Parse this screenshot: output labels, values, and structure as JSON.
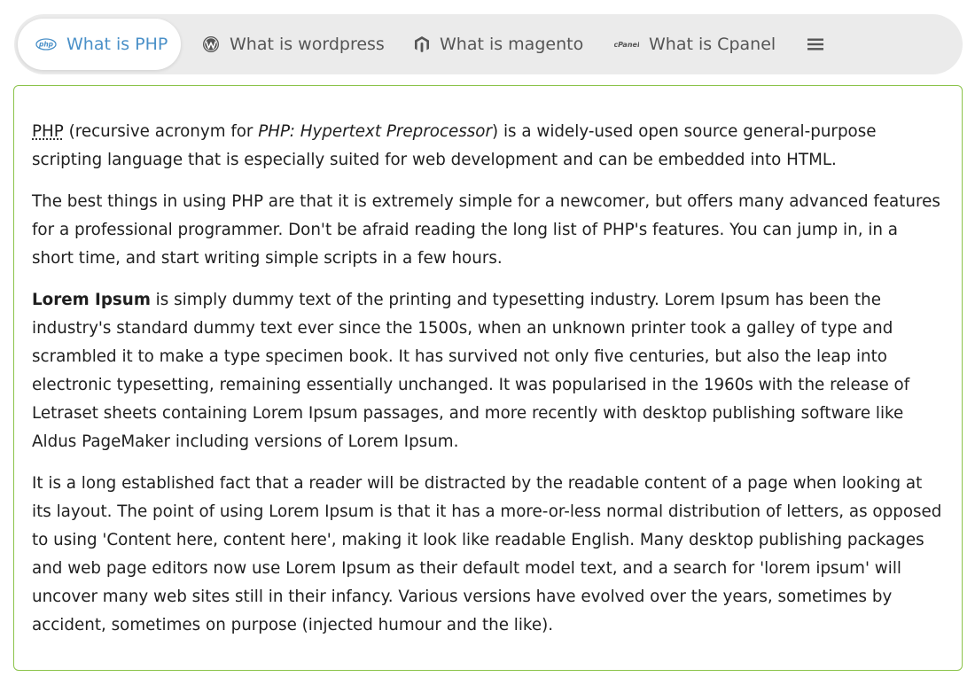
{
  "tabs": [
    {
      "label": "What is PHP",
      "icon": "php-icon",
      "active": true
    },
    {
      "label": "What is wordpress",
      "icon": "wordpress-icon",
      "active": false
    },
    {
      "label": "What is magento",
      "icon": "magento-icon",
      "active": false
    },
    {
      "label": "What is Cpanel",
      "icon": "cpanel-icon",
      "active": false
    }
  ],
  "icons": {
    "php_text": "php",
    "cpanel_text": "cPanel"
  },
  "colors": {
    "active_tab_text": "#4a90c8",
    "tab_text": "#555555",
    "tabbar_bg": "#ebebeb",
    "panel_border": "#8bc34a"
  },
  "content": {
    "p1": {
      "abbr": "PHP",
      "text1": " (recursive acronym for ",
      "em": "PHP: Hypertext Preprocessor",
      "text2": ") is a widely-used open source general-purpose scripting language that is especially suited for web development and can be embedded into HTML."
    },
    "p2": "The best things in using PHP are that it is extremely simple for a newcomer, but offers many advanced features for a professional programmer. Don't be afraid reading the long list of PHP's features. You can jump in, in a short time, and start writing simple scripts in a few hours.",
    "p3": {
      "strong": "Lorem Ipsum",
      "text": " is simply dummy text of the printing and typesetting industry. Lorem Ipsum has been the industry's standard dummy text ever since the 1500s, when an unknown printer took a galley of type and scrambled it to make a type specimen book. It has survived not only five centuries, but also the leap into electronic typesetting, remaining essentially unchanged. It was popularised in the 1960s with the release of Letraset sheets containing Lorem Ipsum passages, and more recently with desktop publishing software like Aldus PageMaker including versions of Lorem Ipsum."
    },
    "p4": "It is a long established fact that a reader will be distracted by the readable content of a page when looking at its layout. The point of using Lorem Ipsum is that it has a more-or-less normal distribution of letters, as opposed to using 'Content here, content here', making it look like readable English. Many desktop publishing packages and web page editors now use Lorem Ipsum as their default model text, and a search for 'lorem ipsum' will uncover many web sites still in their infancy. Various versions have evolved over the years, sometimes by accident, sometimes on purpose (injected humour and the like)."
  }
}
